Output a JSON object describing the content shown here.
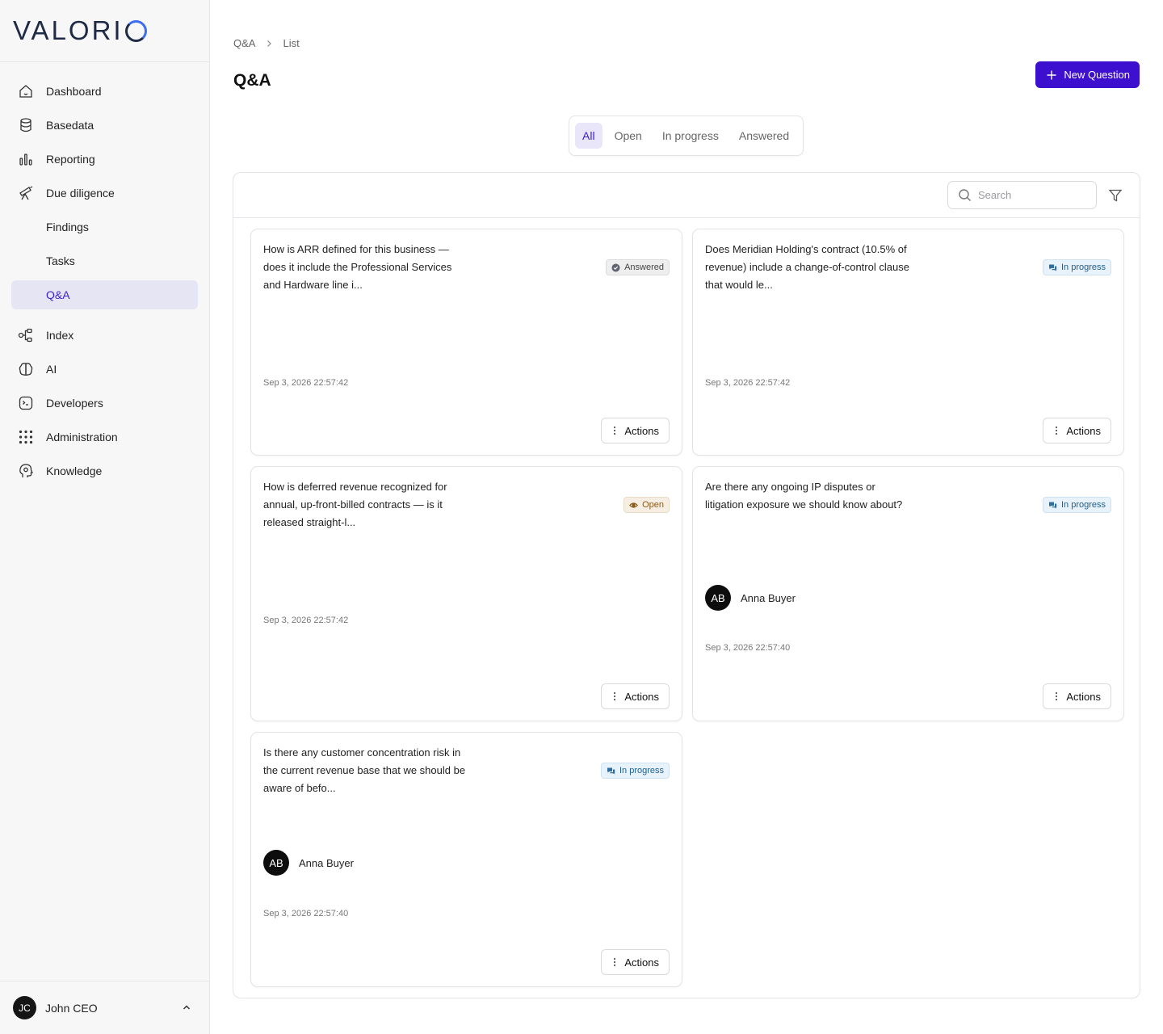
{
  "brand": {
    "logo_text": "VALORI",
    "accent": "#3d0fcf",
    "logo_blue": "#3a6df0"
  },
  "sidebar": {
    "items": [
      {
        "label": "Dashboard",
        "icon": "home-icon"
      },
      {
        "label": "Basedata",
        "icon": "database-icon"
      },
      {
        "label": "Reporting",
        "icon": "bar-chart-icon"
      },
      {
        "label": "Due diligence",
        "icon": "telescope-icon"
      },
      {
        "label": "Findings",
        "sub": true
      },
      {
        "label": "Tasks",
        "sub": true
      },
      {
        "label": "Q&A",
        "sub": true,
        "active": true
      },
      {
        "label": "Index",
        "icon": "nodes-icon"
      },
      {
        "label": "AI",
        "icon": "brain-icon"
      },
      {
        "label": "Developers",
        "icon": "terminal-icon"
      },
      {
        "label": "Administration",
        "icon": "grid-icon"
      },
      {
        "label": "Knowledge",
        "icon": "head-icon"
      }
    ],
    "user": {
      "initials": "JC",
      "name": "John CEO"
    }
  },
  "breadcrumb": {
    "root": "Q&A",
    "current": "List"
  },
  "page": {
    "title": "Q&A",
    "new_button": "New Question"
  },
  "tabs": [
    {
      "label": "All",
      "active": true
    },
    {
      "label": "Open"
    },
    {
      "label": "In progress"
    },
    {
      "label": "Answered"
    }
  ],
  "search": {
    "placeholder": "Search"
  },
  "cards": [
    {
      "question": "How is ARR defined for this business — does it include the Professional Services and Hardware line i...",
      "status": "Answered",
      "date": "Sep 3, 2026 22:57:42",
      "actions": "Actions"
    },
    {
      "question": "Does Meridian Holding's contract (10.5% of revenue) include a change-of-control clause that would le...",
      "status": "In progress",
      "date": "Sep 3, 2026 22:57:42",
      "actions": "Actions"
    },
    {
      "question": "How is deferred revenue recognized for annual, up-front-billed contracts — is it released straight-l...",
      "status": "Open",
      "date": "Sep 3, 2026 22:57:42",
      "actions": "Actions"
    },
    {
      "question": "Are there any ongoing IP disputes or litigation exposure we should know about?",
      "status": "In progress",
      "assignee": {
        "initials": "AB",
        "name": "Anna Buyer"
      },
      "date": "Sep 3, 2026 22:57:40",
      "actions": "Actions"
    },
    {
      "question": "Is there any customer concentration risk in the current revenue base that we should be aware of befo...",
      "status": "In progress",
      "assignee": {
        "initials": "AB",
        "name": "Anna Buyer"
      },
      "date": "Sep 3, 2026 22:57:40",
      "actions": "Actions"
    }
  ]
}
